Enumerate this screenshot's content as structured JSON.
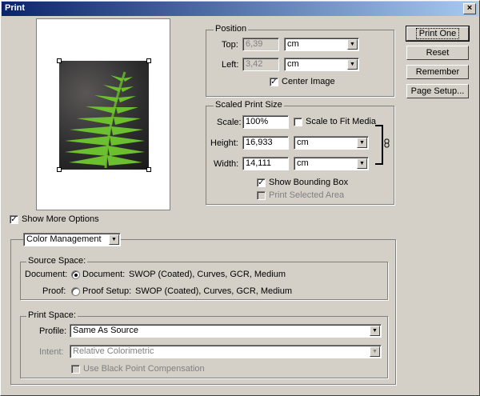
{
  "window": {
    "title": "Print",
    "close_glyph": "×"
  },
  "buttons": {
    "print_one": "Print One",
    "reset": "Reset",
    "remember": "Remember",
    "page_setup": "Page Setup..."
  },
  "position": {
    "legend": "Position",
    "top_label": "Top:",
    "top_value": "6,39",
    "top_unit": "cm",
    "left_label": "Left:",
    "left_value": "3,42",
    "left_unit": "cm",
    "center_image": "Center Image",
    "center_checked": true
  },
  "scaled": {
    "legend": "Scaled Print Size",
    "scale_label": "Scale:",
    "scale_value": "100%",
    "scale_to_fit": "Scale to Fit Media",
    "height_label": "Height:",
    "height_value": "16,933",
    "height_unit": "cm",
    "width_label": "Width:",
    "width_value": "14,111",
    "width_unit": "cm",
    "show_bounding": "Show Bounding Box",
    "show_bounding_checked": true,
    "print_selected": "Print Selected Area"
  },
  "show_more_options": "Show More Options",
  "color_mgmt": {
    "select": "Color Management",
    "source_legend": "Source Space:",
    "document_label": "Document:",
    "document_option": "Document:",
    "document_value": "SWOP (Coated), Curves, GCR, Medium",
    "proof_label": "Proof:",
    "proof_option": "Proof Setup:",
    "proof_value": "SWOP (Coated), Curves, GCR, Medium",
    "print_legend": "Print Space:",
    "profile_label": "Profile:",
    "profile_value": "Same As Source",
    "intent_label": "Intent:",
    "intent_value": "Relative Colorimetric",
    "black_point": "Use Black Point Compensation"
  },
  "icons": {
    "dropdown": "chevron-down-icon",
    "check": "check-icon",
    "link": "chain-link-icon"
  },
  "colors": {
    "titlebar_start": "#0a246a",
    "titlebar_end": "#a6caf0",
    "dialog_bg": "#d4d0c8",
    "fern": "#5fa52a"
  }
}
